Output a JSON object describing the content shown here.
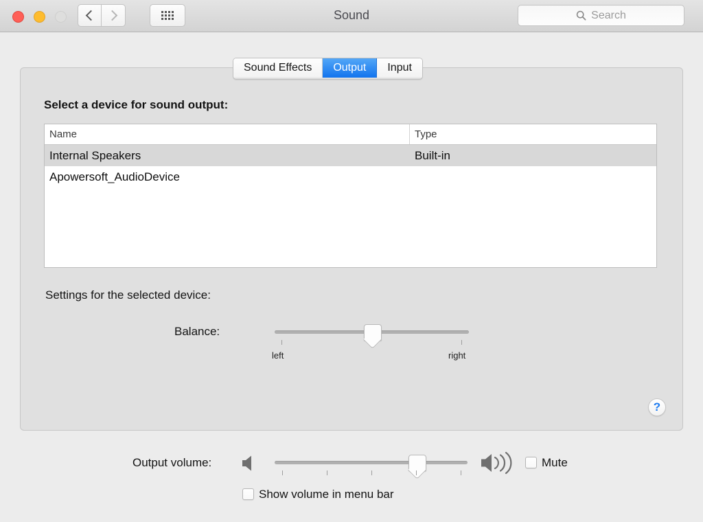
{
  "window": {
    "title": "Sound",
    "traffic_lights": {
      "close": "close-button",
      "minimize": "minimize-button",
      "zoom": "zoom-button"
    },
    "nav": {
      "back": "back-button",
      "forward": "forward-button",
      "show_all": "show-all-button"
    },
    "search": {
      "placeholder": "Search",
      "value": ""
    }
  },
  "tabs": [
    {
      "label": "Sound Effects",
      "selected": false
    },
    {
      "label": "Output",
      "selected": true
    },
    {
      "label": "Input",
      "selected": false
    }
  ],
  "main": {
    "select_device_label": "Select a device for sound output:",
    "table": {
      "columns": [
        "Name",
        "Type"
      ],
      "rows": [
        {
          "name": "Internal Speakers",
          "type": "Built-in",
          "selected": true
        },
        {
          "name": "Apowersoft_AudioDevice",
          "type": "",
          "selected": false
        }
      ]
    },
    "settings_label": "Settings for the selected device:",
    "balance": {
      "label": "Balance:",
      "min_label": "left",
      "max_label": "right",
      "value_percent": 50
    },
    "help_label": "?"
  },
  "bottom": {
    "output_volume_label": "Output volume:",
    "volume_value_percent": 70,
    "mute": {
      "label": "Mute",
      "checked": false
    },
    "show_in_menu_bar": {
      "label": "Show volume in menu bar",
      "checked": false
    }
  },
  "colors": {
    "accent_blue": "#1274ee",
    "window_background": "#ececec",
    "panel_background": "#e0e0e0",
    "selected_row": "#d8d8d8",
    "traffic_close": "#ff5f57",
    "traffic_minimize": "#febc2e",
    "traffic_zoom": "#dededd",
    "help_glyph": "#1f7cf0"
  }
}
